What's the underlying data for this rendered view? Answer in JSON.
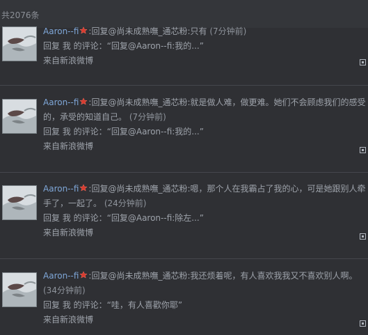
{
  "header": {
    "total_label": "共2076条"
  },
  "feed": {
    "items": [
      {
        "username": "Aaron--fi",
        "star_icon": "star-badge-icon",
        "content": ":回复@尚未成熟嘸_通芯粉:只有",
        "time": "(7分钟前)",
        "reply_label": "回复 我 的评论：",
        "reply_quote": "“回复@Aaron--fi:我的...”",
        "source": "来自新浪微博"
      },
      {
        "username": "Aaron--fi",
        "star_icon": "star-badge-icon",
        "content": ":回复@尚未成熟嘸_通芯粉:就是做人难，做更难。她们不会顾虑我们的感受的，承受的知道自己。",
        "time": "(7分钟前)",
        "reply_label": "回复 我 的评论：",
        "reply_quote": "“回复@Aaron--fi:我的...”",
        "source": "来自新浪微博"
      },
      {
        "username": "Aaron--fi",
        "star_icon": "star-badge-icon",
        "content": ":回复@尚未成熟嘸_通芯粉:嗯，那个人在我霸占了我的心，可是她跟别人牵手了，一起了。",
        "time": "(24分钟前)",
        "reply_label": "回复 我 的评论：",
        "reply_quote": "“回复@Aaron--fi:除左...”",
        "source": "来自新浪微博"
      },
      {
        "username": "Aaron--fi",
        "star_icon": "star-badge-icon",
        "content": ":回复@尚未成熟嘸_通芯粉:我还烦着呢，有人喜欢我我又不喜欢别人啊。",
        "time": "(34分钟前)",
        "reply_label": "回复 我 的评论：",
        "reply_quote": "“哇，有人喜歡你耶”",
        "source": "来自新浪微博"
      }
    ]
  }
}
